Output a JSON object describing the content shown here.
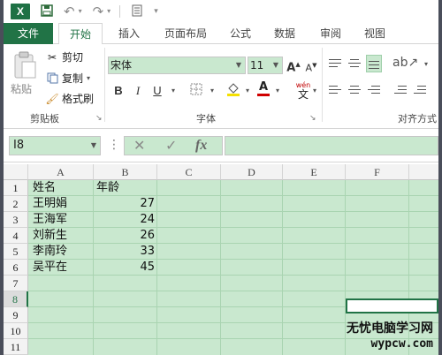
{
  "qat": {
    "app_badge": "X"
  },
  "tabs": [
    "文件",
    "开始",
    "插入",
    "页面布局",
    "公式",
    "数据",
    "审阅",
    "视图"
  ],
  "ribbon": {
    "clipboard": {
      "paste_label": "粘贴",
      "cut_label": "剪切",
      "copy_label": "复制",
      "format_painter_label": "格式刷",
      "group_label": "剪贴板"
    },
    "font": {
      "font_name": "宋体",
      "font_size": "11",
      "bold": "B",
      "italic": "I",
      "underline": "U",
      "grow": "A",
      "shrink": "A",
      "font_color_letter": "A",
      "wen_label": "wén",
      "wen_char": "文",
      "group_label": "字体"
    },
    "alignment": {
      "group_label": "对齐方式"
    }
  },
  "formula_bar": {
    "name_box": "I8",
    "cancel": "✕",
    "enter": "✓",
    "fx": "fx",
    "formula": ""
  },
  "sheet": {
    "columns": [
      "A",
      "B",
      "C",
      "D",
      "E",
      "F"
    ],
    "rows": [
      "1",
      "2",
      "3",
      "4",
      "5",
      "6",
      "7",
      "8",
      "9",
      "10",
      "11"
    ],
    "selected_row": "8",
    "data": [
      [
        "姓名",
        "年龄"
      ],
      [
        "王明娟",
        "27"
      ],
      [
        "王海军",
        "24"
      ],
      [
        "刘新生",
        "26"
      ],
      [
        "李南玲",
        "33"
      ],
      [
        "吴平在",
        "45"
      ]
    ]
  },
  "watermark": {
    "line1": "无忧电脑学习网",
    "line2": "wypcw.com"
  },
  "colors": {
    "accent": "#217346",
    "cell_fill": "#c9e8cf",
    "frame": "#4a4e5a"
  }
}
